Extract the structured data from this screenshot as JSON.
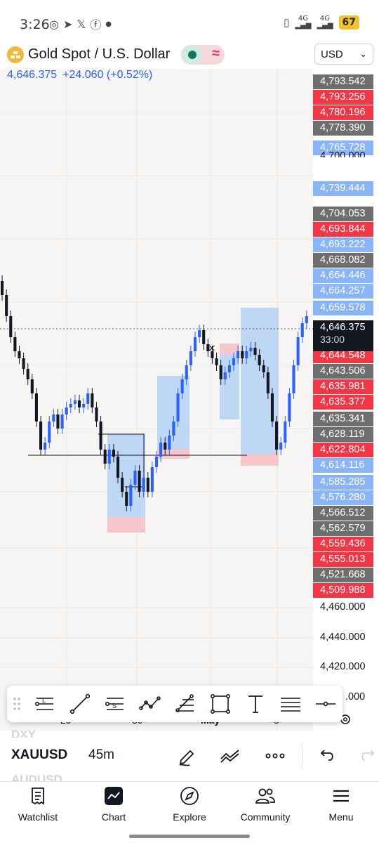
{
  "status_bar": {
    "time": "3:26",
    "battery": "67",
    "network_1": "4G",
    "network_2": "4G"
  },
  "header": {
    "symbol_title": "Gold Spot / U.S. Dollar",
    "currency": "USD",
    "last_price": "4,646.375",
    "change": "+24.060 (+0.52%)",
    "logo_icon": "gold-bars-icon",
    "market_status_icon": "market-open-dot-icon",
    "data_status_icon": "delayed-wave-icon"
  },
  "price_scale": {
    "tags": [
      {
        "value": "4,793.542",
        "color": "gray"
      },
      {
        "value": "4,793.256",
        "color": "red"
      },
      {
        "value": "4,780.196",
        "color": "red"
      },
      {
        "value": "4,778.390",
        "color": "gray"
      },
      {
        "value": "4,765.728",
        "color": "blue"
      },
      {
        "value": "4,739.444",
        "color": "blue"
      },
      {
        "value": "4,704.053",
        "color": "gray"
      },
      {
        "value": "4,693.844",
        "color": "red"
      },
      {
        "value": "4,693.222",
        "color": "blue"
      },
      {
        "value": "4,668.082",
        "color": "gray"
      },
      {
        "value": "4,664.446",
        "color": "blue"
      },
      {
        "value": "4,664.257",
        "color": "blue"
      },
      {
        "value": "4,659.578",
        "color": "blue"
      },
      {
        "value": "4,644.548",
        "color": "red"
      },
      {
        "value": "4,643.506",
        "color": "gray"
      },
      {
        "value": "4,635.981",
        "color": "red"
      },
      {
        "value": "4,635.377",
        "color": "red"
      },
      {
        "value": "4,635.341",
        "color": "gray"
      },
      {
        "value": "4,628.119",
        "color": "gray"
      },
      {
        "value": "4,622.804",
        "color": "red"
      },
      {
        "value": "4,614.116",
        "color": "blue"
      },
      {
        "value": "4,585.285",
        "color": "blue"
      },
      {
        "value": "4,576.280",
        "color": "blue"
      },
      {
        "value": "4,566.512",
        "color": "gray"
      },
      {
        "value": "4,562.579",
        "color": "gray"
      },
      {
        "value": "4,559.436",
        "color": "red"
      },
      {
        "value": "4,555.013",
        "color": "red"
      },
      {
        "value": "4,521.668",
        "color": "gray"
      },
      {
        "value": "4,509.988",
        "color": "red"
      }
    ],
    "current_price": "4,646.375",
    "countdown": "33:00",
    "labels": [
      "4,460.000",
      "4,440.000",
      "4,420.000",
      ".000"
    ],
    "partial_label": "4,700.000"
  },
  "time_axis": {
    "labels": [
      "29",
      "30",
      "May",
      "5"
    ]
  },
  "drawing_toolbar": {
    "tools": [
      "long-position-icon",
      "trend-line-icon",
      "short-position-icon",
      "path-icon",
      "fib-retracement-icon",
      "rectangle-icon",
      "text-icon",
      "parallel-lines-icon",
      "horizontal-ray-icon"
    ]
  },
  "symbol_bar": {
    "prev_symbol": "DXY",
    "symbol": "XAUUSD",
    "interval": "45m",
    "next_symbol": "AUDUSD"
  },
  "bottom_nav": {
    "items": [
      {
        "label": "Watchlist",
        "icon": "watchlist-icon"
      },
      {
        "label": "Chart",
        "icon": "chart-icon"
      },
      {
        "label": "Explore",
        "icon": "compass-icon"
      },
      {
        "label": "Community",
        "icon": "community-icon"
      },
      {
        "label": "Menu",
        "icon": "hamburger-menu-icon"
      }
    ]
  },
  "colors": {
    "accent_blue": "#2962ff",
    "up_candle": "#2962ff",
    "down_candle": "#131722",
    "sell_red": "#f23645",
    "zone_blue": "#b3d1f5",
    "zone_red": "#f7c6cb"
  }
}
